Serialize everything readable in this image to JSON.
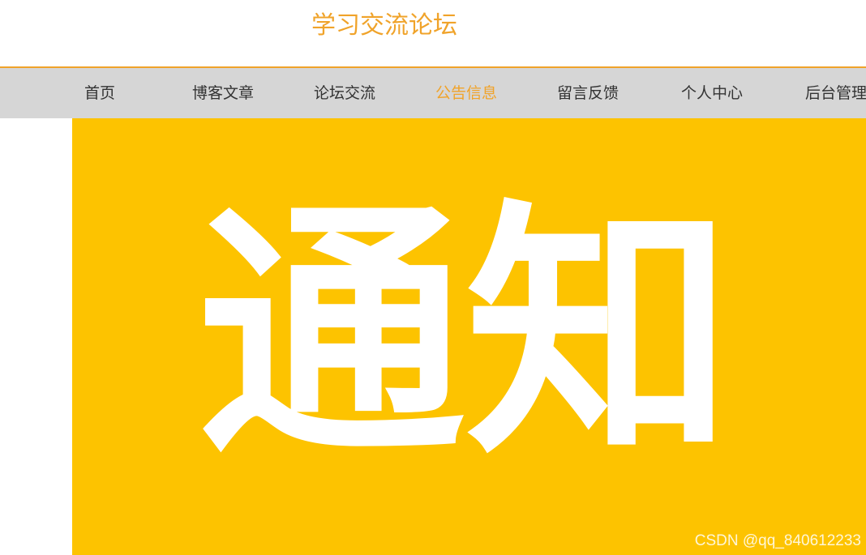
{
  "site": {
    "title": "学习交流论坛"
  },
  "nav": {
    "items": [
      {
        "label": "首页"
      },
      {
        "label": "博客文章"
      },
      {
        "label": "论坛交流"
      },
      {
        "label": "公告信息",
        "active": true
      },
      {
        "label": "留言反馈"
      },
      {
        "label": "个人中心"
      },
      {
        "label": "后台管理"
      }
    ]
  },
  "banner": {
    "text": "通知",
    "background_color": "#fdc300",
    "text_color": "#ffffff"
  },
  "watermark": {
    "text": "CSDN @qq_840612233"
  },
  "colors": {
    "accent": "#f0a32a",
    "nav_bg": "#d6d6d6"
  }
}
